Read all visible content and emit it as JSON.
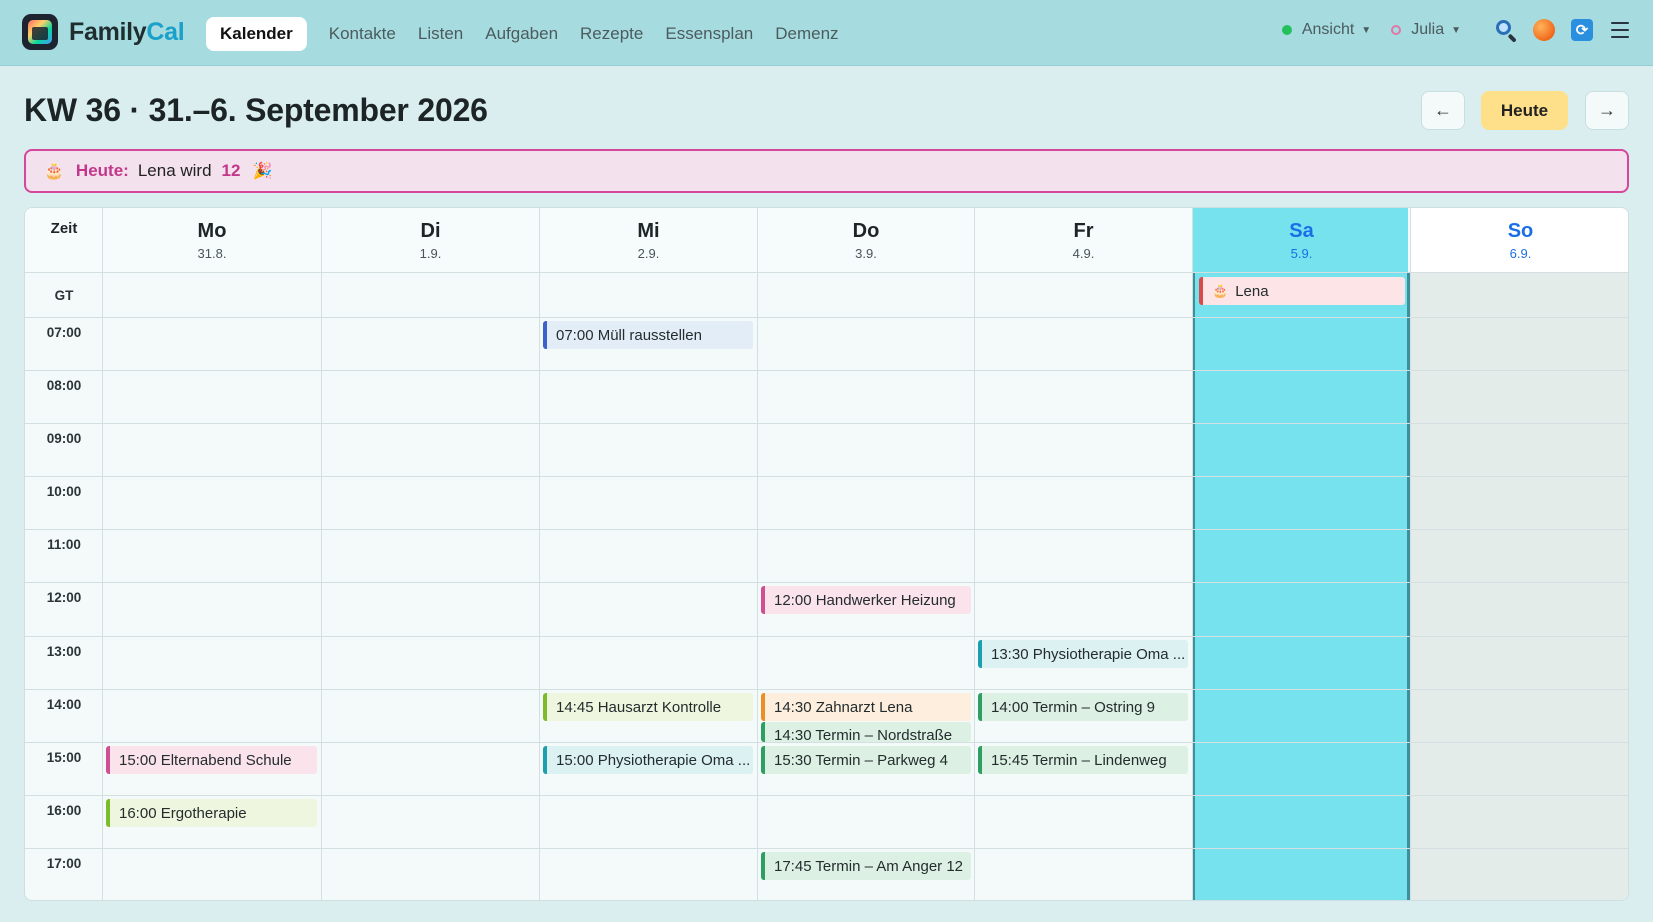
{
  "app": {
    "name_part1": "Family",
    "name_part2": "Cal",
    "accent": "#1aa0c9"
  },
  "nav": {
    "items": [
      {
        "label": "Kalender",
        "active": true
      },
      {
        "label": "Kontakte"
      },
      {
        "label": "Listen"
      },
      {
        "label": "Aufgaben"
      },
      {
        "label": "Rezepte"
      },
      {
        "label": "Essensplan"
      },
      {
        "label": "Demenz"
      }
    ]
  },
  "toolbar": {
    "view_label": "Ansicht",
    "user_label": "Julia",
    "icons": [
      "search-icon",
      "orange-dot-icon",
      "sync-icon",
      "menu-icon"
    ]
  },
  "header": {
    "title": "KW 36 · 31.–6. September 2026",
    "prev_label": "←",
    "today_label": "Heute",
    "next_label": "→"
  },
  "banner": {
    "prefix": "Heute:",
    "text": "Lena wird",
    "age": "12",
    "icons": [
      "cake-icon",
      "party-icon"
    ]
  },
  "calendar": {
    "time_header": "Zeit",
    "allday_label": "GT",
    "days": [
      {
        "name": "Mo",
        "date": "31.8."
      },
      {
        "name": "Di",
        "date": "1.9."
      },
      {
        "name": "Mi",
        "date": "2.9."
      },
      {
        "name": "Do",
        "date": "3.9."
      },
      {
        "name": "Fr",
        "date": "4.9."
      },
      {
        "name": "Sa",
        "date": "5.9.",
        "today": true
      },
      {
        "name": "So",
        "date": "6.9."
      }
    ],
    "hours": [
      "07:00",
      "08:00",
      "09:00",
      "10:00",
      "11:00",
      "12:00",
      "13:00",
      "14:00",
      "15:00",
      "16:00",
      "17:00"
    ],
    "allday_events": [
      {
        "day": "Sa",
        "title": "Lena",
        "icon": "cake-icon",
        "color": "#d84a4a"
      }
    ],
    "events": [
      {
        "day": "Mi",
        "text": "07:00 Müll rausstellen",
        "color": "#3b62c9"
      },
      {
        "day": "Do",
        "text": "12:00 Handwerker Heizung",
        "color": "#d04f94"
      },
      {
        "day": "Fr",
        "text": "13:30 Physiotherapie Oma ...",
        "color": "#1b9fae"
      },
      {
        "day": "Mi",
        "text": "14:45 Hausarzt Kontrolle",
        "color": "#7cbc2b"
      },
      {
        "day": "Do",
        "text": "14:30 Zahnarzt Lena",
        "color": "#ec8e25"
      },
      {
        "day": "Do",
        "text": "14:30 Termin – Nordstraße",
        "color": "#2f9e63"
      },
      {
        "day": "Fr",
        "text": "14:00 Termin – Ostring 9",
        "color": "#2f9e63"
      },
      {
        "day": "Mo",
        "text": "15:00 Elternabend Schule",
        "color": "#d04f94"
      },
      {
        "day": "Mi",
        "text": "15:00 Physiotherapie Oma ...",
        "color": "#1b9fae"
      },
      {
        "day": "Do",
        "text": "15:30 Termin – Parkweg 4",
        "color": "#2f9e63"
      },
      {
        "day": "Fr",
        "text": "15:45 Termin – Lindenweg",
        "color": "#2f9e63"
      },
      {
        "day": "Mo",
        "text": "16:00 Ergotherapie",
        "color": "#7cbc2b"
      },
      {
        "day": "Do",
        "text": "17:45 Termin – Am Anger 12",
        "color": "#2f9e63"
      }
    ]
  }
}
